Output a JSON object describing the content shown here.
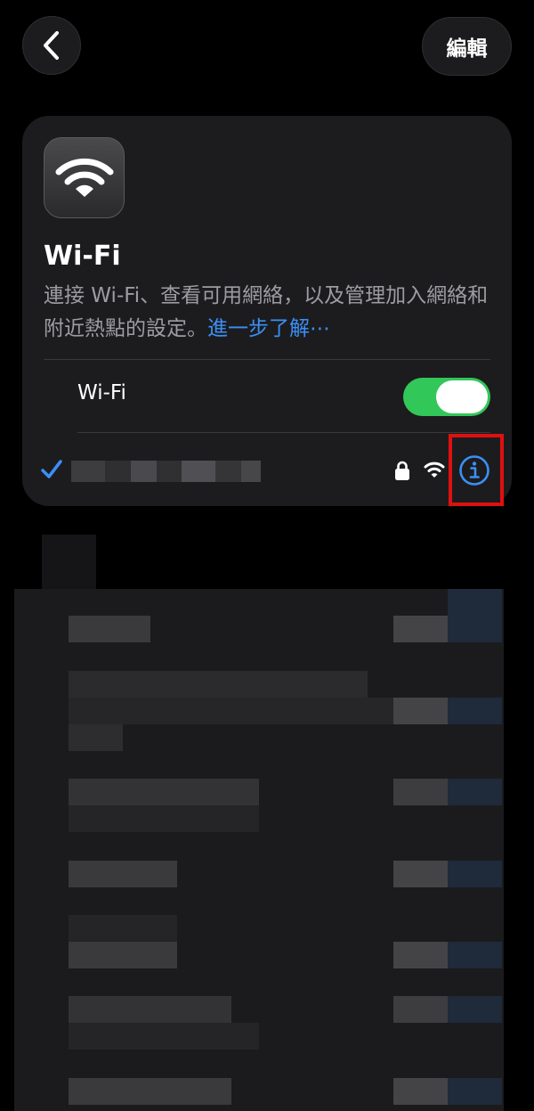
{
  "nav": {
    "back_icon": "chevron-left-icon",
    "edit_label": "編輯"
  },
  "card": {
    "icon": "wifi-icon",
    "title": "Wi-Fi",
    "description": "連接 Wi-Fi、查看可用網絡，以及管理加入網絡和附近熱點的設定。",
    "learn_more": "進一步了解⋯",
    "toggle_label": "Wi-Fi",
    "toggle_on": true
  },
  "current_network": {
    "connected": true,
    "name_obscured": true,
    "secured": true,
    "icons": [
      "checkmark-icon",
      "lock-icon",
      "wifi-signal-icon",
      "info-icon"
    ]
  },
  "other_networks": {
    "obscured": true
  },
  "colors": {
    "accent": "#3b8ff5",
    "toggle_on": "#32c759",
    "card_bg": "#1c1c1e",
    "secondary_text": "#9c9ca2",
    "highlight": "#e01010"
  }
}
